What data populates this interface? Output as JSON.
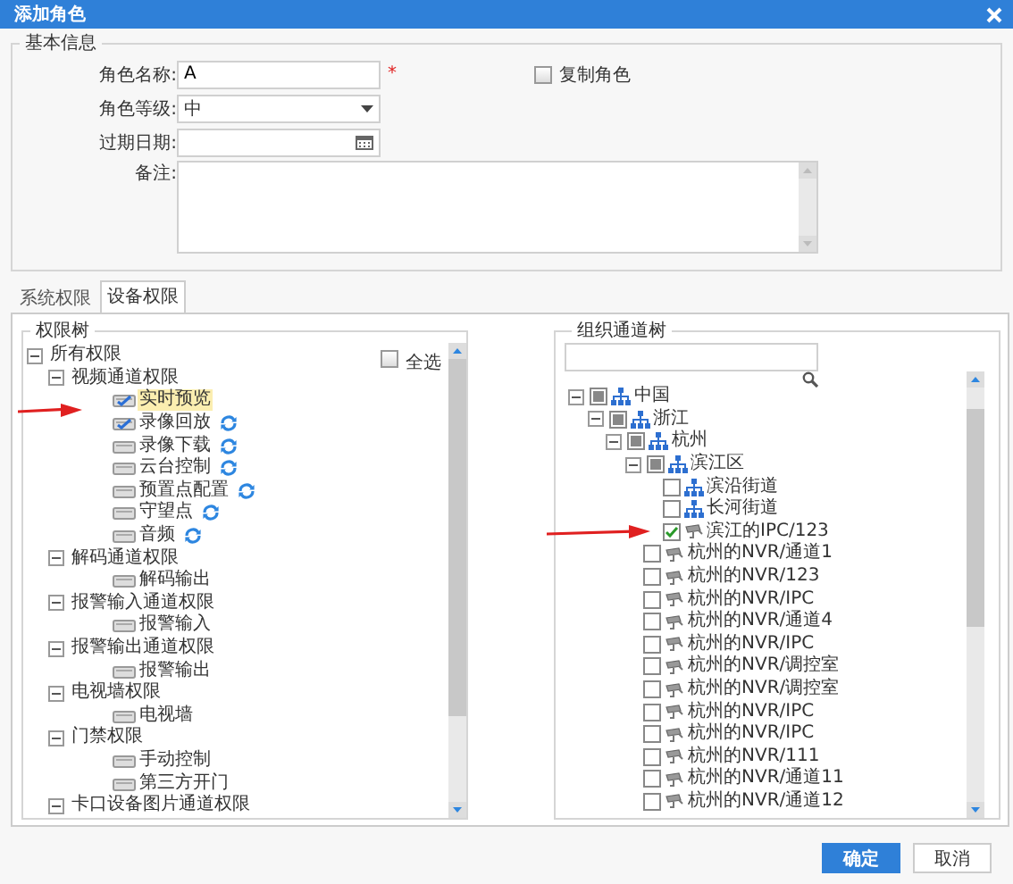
{
  "window": {
    "title": "添加角色"
  },
  "basic_info": {
    "title": "基本信息",
    "name": {
      "label": "角色名称:",
      "value": "A",
      "required_mark": "*"
    },
    "copy_role": {
      "label": "复制角色",
      "checked": false
    },
    "level": {
      "label": "角色等级:",
      "value": "中"
    },
    "expiry": {
      "label": "过期日期:"
    },
    "remarks": {
      "label": "备注:"
    }
  },
  "tabs": [
    {
      "label": "系统权限",
      "selected": false
    },
    {
      "label": "设备权限",
      "selected": true
    }
  ],
  "permission_tree": {
    "title": "权限树",
    "select_all": {
      "label": "全选",
      "checked": false
    },
    "items": [
      {
        "label": "所有权限",
        "kind": "group",
        "expanded": true,
        "children": [
          {
            "label": "视频通道权限",
            "kind": "group",
            "expanded": true,
            "children": [
              {
                "label": "实时预览",
                "kind": "perm",
                "checked": true,
                "selected": true,
                "sync": false
              },
              {
                "label": "录像回放",
                "kind": "perm",
                "checked": true,
                "selected": false,
                "sync": true
              },
              {
                "label": "录像下载",
                "kind": "perm",
                "checked": false,
                "selected": false,
                "sync": true
              },
              {
                "label": "云台控制",
                "kind": "perm",
                "checked": false,
                "selected": false,
                "sync": true
              },
              {
                "label": "预置点配置",
                "kind": "perm",
                "checked": false,
                "selected": false,
                "sync": true
              },
              {
                "label": "守望点",
                "kind": "perm",
                "checked": false,
                "selected": false,
                "sync": true
              },
              {
                "label": "音频",
                "kind": "perm",
                "checked": false,
                "selected": false,
                "sync": true
              }
            ]
          },
          {
            "label": "解码通道权限",
            "kind": "group",
            "expanded": true,
            "children": [
              {
                "label": "解码输出",
                "kind": "perm",
                "checked": false,
                "selected": false,
                "sync": false
              }
            ]
          },
          {
            "label": "报警输入通道权限",
            "kind": "group",
            "expanded": true,
            "children": [
              {
                "label": "报警输入",
                "kind": "perm",
                "checked": false,
                "selected": false,
                "sync": false
              }
            ]
          },
          {
            "label": "报警输出通道权限",
            "kind": "group",
            "expanded": true,
            "children": [
              {
                "label": "报警输出",
                "kind": "perm",
                "checked": false,
                "selected": false,
                "sync": false
              }
            ]
          },
          {
            "label": "电视墙权限",
            "kind": "group",
            "expanded": true,
            "children": [
              {
                "label": "电视墙",
                "kind": "perm",
                "checked": false,
                "selected": false,
                "sync": false
              }
            ]
          },
          {
            "label": "门禁权限",
            "kind": "group",
            "expanded": true,
            "children": [
              {
                "label": "手动控制",
                "kind": "perm",
                "checked": false,
                "selected": false,
                "sync": false
              },
              {
                "label": "第三方开门",
                "kind": "perm",
                "checked": false,
                "selected": false,
                "sync": false
              }
            ]
          },
          {
            "label": "卡口设备图片通道权限",
            "kind": "group",
            "expanded": true
          }
        ]
      }
    ]
  },
  "channel_tree": {
    "title": "组织通道树",
    "items": [
      {
        "label": "中国",
        "kind": "org",
        "checked": false,
        "partial": true,
        "expanded": true,
        "children": [
          {
            "label": "浙江",
            "kind": "org",
            "checked": false,
            "partial": true,
            "expanded": true,
            "children": [
              {
                "label": "杭州",
                "kind": "org",
                "checked": false,
                "partial": true,
                "expanded": true,
                "children": [
                  {
                    "label": "滨江区",
                    "kind": "org",
                    "checked": false,
                    "partial": true,
                    "expanded": true,
                    "children": [
                      {
                        "label": "滨沿街道",
                        "kind": "org",
                        "checked": false,
                        "partial": false
                      },
                      {
                        "label": "长河街道",
                        "kind": "org",
                        "checked": false,
                        "partial": false
                      },
                      {
                        "label": "滨江的IPC/123",
                        "kind": "camera",
                        "checked": true,
                        "partial": false
                      }
                    ]
                  },
                  {
                    "label": "杭州的NVR/通道1",
                    "kind": "camera",
                    "checked": false,
                    "partial": false
                  },
                  {
                    "label": "杭州的NVR/123",
                    "kind": "camera",
                    "checked": false,
                    "partial": false
                  },
                  {
                    "label": "杭州的NVR/IPC",
                    "kind": "camera",
                    "checked": false,
                    "partial": false
                  },
                  {
                    "label": "杭州的NVR/通道4",
                    "kind": "camera",
                    "checked": false,
                    "partial": false
                  },
                  {
                    "label": "杭州的NVR/IPC",
                    "kind": "camera",
                    "checked": false,
                    "partial": false
                  },
                  {
                    "label": "杭州的NVR/调控室",
                    "kind": "camera",
                    "checked": false,
                    "partial": false
                  },
                  {
                    "label": "杭州的NVR/调控室",
                    "kind": "camera",
                    "checked": false,
                    "partial": false
                  },
                  {
                    "label": "杭州的NVR/IPC",
                    "kind": "camera",
                    "checked": false,
                    "partial": false
                  },
                  {
                    "label": "杭州的NVR/IPC",
                    "kind": "camera",
                    "checked": false,
                    "partial": false
                  },
                  {
                    "label": "杭州的NVR/111",
                    "kind": "camera",
                    "checked": false,
                    "partial": false
                  },
                  {
                    "label": "杭州的NVR/通道11",
                    "kind": "camera",
                    "checked": false,
                    "partial": false
                  },
                  {
                    "label": "杭州的NVR/通道12",
                    "kind": "camera",
                    "checked": false,
                    "partial": false
                  }
                ]
              }
            ]
          }
        ]
      }
    ]
  },
  "buttons": [
    {
      "label": "确定",
      "kind": "primary"
    },
    {
      "label": "取消",
      "kind": "secondary"
    }
  ]
}
